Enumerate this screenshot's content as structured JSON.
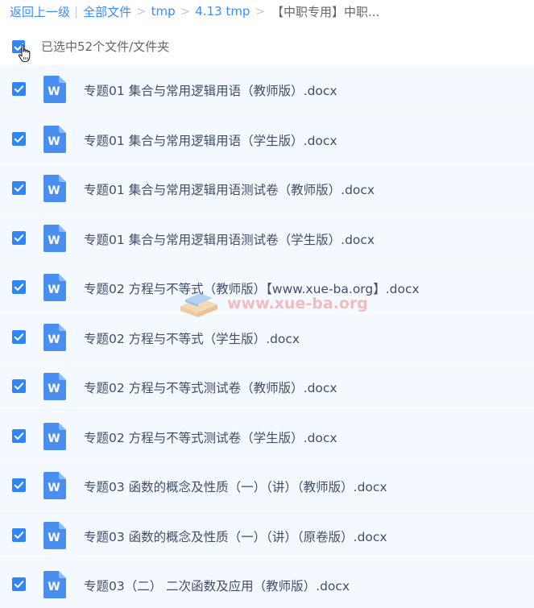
{
  "breadcrumb": {
    "back": "返回上一级",
    "all_files": "全部文件",
    "folder1": "tmp",
    "folder2": "4.13 tmp",
    "current": "【中职专用】中职..."
  },
  "selection": {
    "text": "已选中52个文件/文件夹",
    "all_checked": true
  },
  "files": [
    {
      "name": "专题01 集合与常用逻辑用语（教师版）.docx",
      "checked": true,
      "icon": "word-doc-icon"
    },
    {
      "name": "专题01 集合与常用逻辑用语（学生版）.docx",
      "checked": true,
      "icon": "word-doc-icon"
    },
    {
      "name": "专题01 集合与常用逻辑用语测试卷（教师版）.docx",
      "checked": true,
      "icon": "word-doc-icon"
    },
    {
      "name": "专题01 集合与常用逻辑用语测试卷（学生版）.docx",
      "checked": true,
      "icon": "word-doc-icon"
    },
    {
      "name": "专题02 方程与不等式（教师版）【www.xue-ba.org】.docx",
      "checked": true,
      "icon": "word-doc-icon"
    },
    {
      "name": "专题02 方程与不等式（学生版）.docx",
      "checked": true,
      "icon": "word-doc-icon"
    },
    {
      "name": "专题02 方程与不等式测试卷（教师版）.docx",
      "checked": true,
      "icon": "word-doc-icon"
    },
    {
      "name": "专题02 方程与不等式测试卷（学生版）.docx",
      "checked": true,
      "icon": "word-doc-icon"
    },
    {
      "name": "专题03 函数的概念及性质（一）（讲）（教师版）.docx",
      "checked": true,
      "icon": "word-doc-icon"
    },
    {
      "name": "专题03 函数的概念及性质（一）（讲）（原卷版）.docx",
      "checked": true,
      "icon": "word-doc-icon"
    },
    {
      "name": "专题03（二） 二次函数及应用（教师版）.docx",
      "checked": true,
      "icon": "word-doc-icon"
    }
  ],
  "watermark": {
    "text": "www.xue-ba.org"
  },
  "colors": {
    "link": "#3b8cff",
    "checkbox": "#2f86f6",
    "row_bg": "#f4f9ff",
    "text": "#424e67",
    "word_icon": "#4a8ef0"
  }
}
